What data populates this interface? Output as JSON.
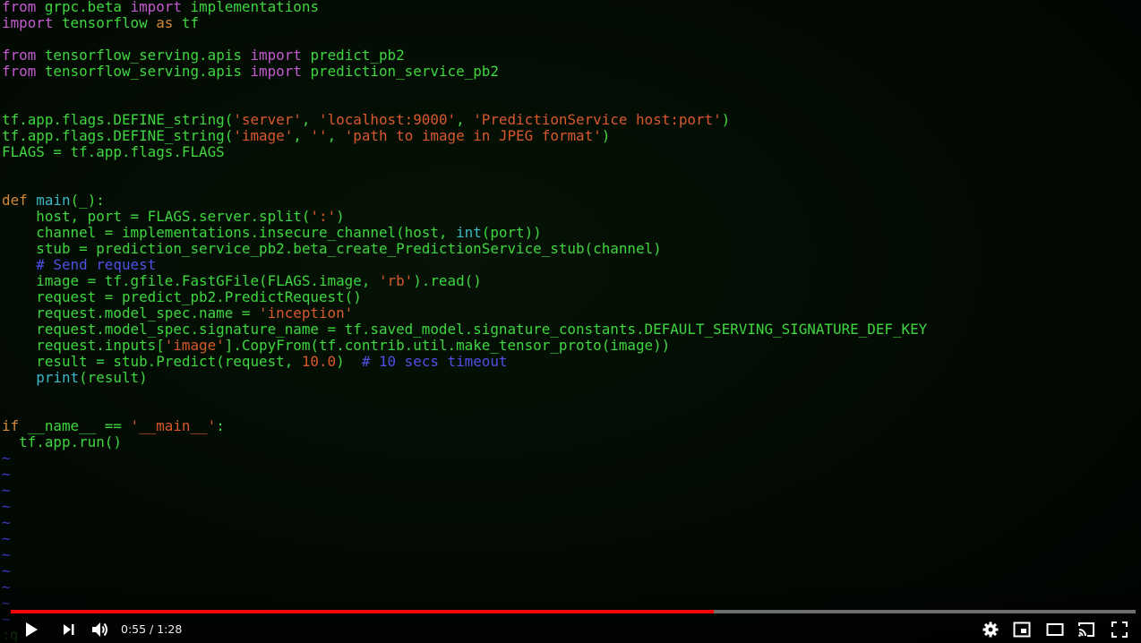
{
  "player": {
    "time_display": "0:55 / 1:28",
    "current_time": "0:55",
    "duration": "1:28",
    "progress_percent": 62.5,
    "progress_color": "#ff0000",
    "controls": [
      "play-icon",
      "next-icon",
      "volume-icon",
      "settings-icon",
      "miniplayer-icon",
      "theater-mode-icon",
      "cast-icon",
      "fullscreen-icon"
    ]
  },
  "editor": {
    "lines": [
      [
        [
          "k",
          "from"
        ],
        [
          "d",
          " grpc.beta "
        ],
        [
          "k",
          "import"
        ],
        [
          "d",
          " implementations"
        ]
      ],
      [
        [
          "k",
          "import"
        ],
        [
          "d",
          " tensorflow "
        ],
        [
          "o",
          "as"
        ],
        [
          "d",
          " tf"
        ]
      ],
      [],
      [
        [
          "k",
          "from"
        ],
        [
          "d",
          " tensorflow_serving.apis "
        ],
        [
          "k",
          "import"
        ],
        [
          "d",
          " predict_pb2"
        ]
      ],
      [
        [
          "k",
          "from"
        ],
        [
          "d",
          " tensorflow_serving.apis "
        ],
        [
          "k",
          "import"
        ],
        [
          "d",
          " prediction_service_pb2"
        ]
      ],
      [],
      [],
      [
        [
          "d",
          "tf.app.flags.DEFINE_string("
        ],
        [
          "s",
          "'server'"
        ],
        [
          "d",
          ", "
        ],
        [
          "s",
          "'localhost:9000'"
        ],
        [
          "d",
          ", "
        ],
        [
          "s",
          "'PredictionService host:port'"
        ],
        [
          "d",
          ")"
        ]
      ],
      [
        [
          "d",
          "tf.app.flags.DEFINE_string("
        ],
        [
          "s",
          "'image'"
        ],
        [
          "d",
          ", "
        ],
        [
          "s",
          "''"
        ],
        [
          "d",
          ", "
        ],
        [
          "s",
          "'path to image in JPEG format'"
        ],
        [
          "d",
          ")"
        ]
      ],
      [
        [
          "d",
          "FLAGS = tf.app.flags.FLAGS"
        ]
      ],
      [],
      [],
      [
        [
          "o",
          "def"
        ],
        [
          "d",
          " "
        ],
        [
          "f",
          "main"
        ],
        [
          "d",
          "(_):"
        ]
      ],
      [
        [
          "d",
          "    host, port = FLAGS.server.split("
        ],
        [
          "s",
          "':'"
        ],
        [
          "d",
          ")"
        ]
      ],
      [
        [
          "d",
          "    channel = implementations.insecure_channel(host, "
        ],
        [
          "f",
          "int"
        ],
        [
          "d",
          "(port))"
        ]
      ],
      [
        [
          "d",
          "    stub = prediction_service_pb2.beta_create_PredictionService_stub(channel)"
        ]
      ],
      [
        [
          "c",
          "    # Send request"
        ]
      ],
      [
        [
          "d",
          "    image = tf.gfile.FastGFile(FLAGS.image, "
        ],
        [
          "s",
          "'rb'"
        ],
        [
          "d",
          ").read()"
        ]
      ],
      [
        [
          "d",
          "    request = predict_pb2.PredictRequest()"
        ]
      ],
      [
        [
          "d",
          "    request.model_spec.name = "
        ],
        [
          "s",
          "'inception'"
        ]
      ],
      [
        [
          "d",
          "    request.model_spec.signature_name = tf.saved_model.signature_constants.DEFAULT_SERVING_SIGNATURE_DEF_KEY"
        ]
      ],
      [
        [
          "d",
          "    request.inputs["
        ],
        [
          "s",
          "'image'"
        ],
        [
          "d",
          "].CopyFrom(tf.contrib.util.make_tensor_proto(image))"
        ]
      ],
      [
        [
          "d",
          "    result = stub.Predict(request, "
        ],
        [
          "n",
          "10.0"
        ],
        [
          "d",
          ")  "
        ],
        [
          "c",
          "# 10 secs timeout"
        ]
      ],
      [
        [
          "f",
          "    print"
        ],
        [
          "d",
          "(result)"
        ]
      ],
      [],
      [],
      [
        [
          "o",
          "if"
        ],
        [
          "d",
          " __name__ == "
        ],
        [
          "s",
          "'__main__'"
        ],
        [
          "d",
          ":"
        ]
      ],
      [
        [
          "d",
          "  tf.app.run()"
        ]
      ]
    ],
    "tilde_count": 11,
    "tilde": "~",
    "command_line": ":q"
  }
}
